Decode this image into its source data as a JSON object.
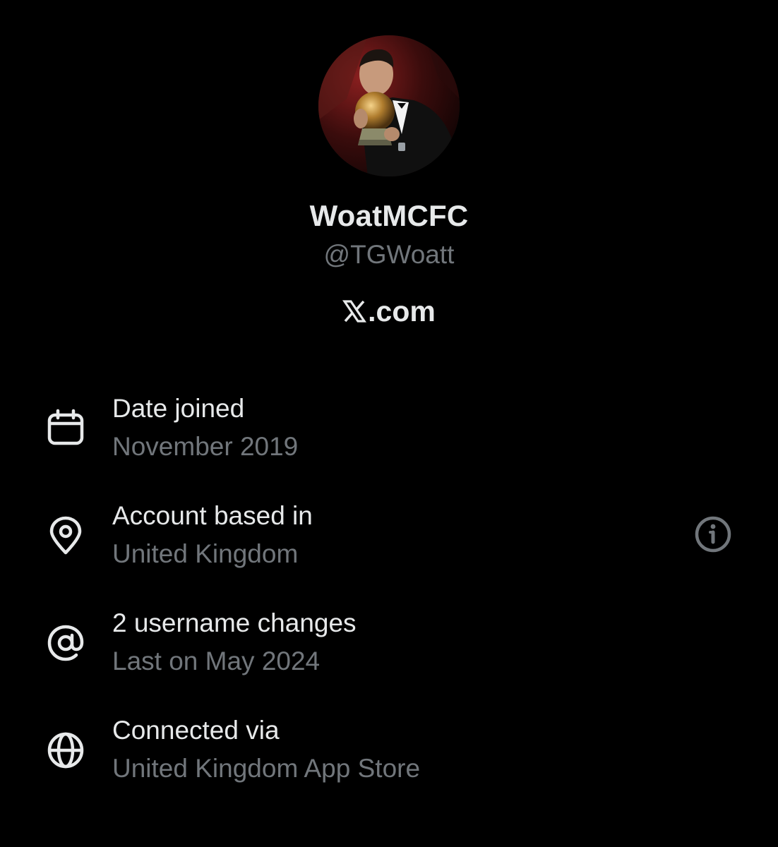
{
  "profile": {
    "display_name": "WoatMCFC",
    "handle": "@TGWoatt",
    "website_suffix": ".com",
    "avatar_icon": "profile-photo"
  },
  "about": {
    "items": [
      {
        "icon": "calendar-icon",
        "title": "Date joined",
        "value": "November 2019"
      },
      {
        "icon": "location-pin-icon",
        "title": "Account based in",
        "value": "United Kingdom",
        "has_info_button": true
      },
      {
        "icon": "at-sign-icon",
        "title": "2 username changes",
        "value": "Last on May 2024"
      },
      {
        "icon": "globe-icon",
        "title": "Connected via",
        "value": "United Kingdom App Store"
      }
    ]
  },
  "colors": {
    "background": "#000000",
    "primary_text": "#e7e9ea",
    "secondary_text": "#71767b"
  }
}
